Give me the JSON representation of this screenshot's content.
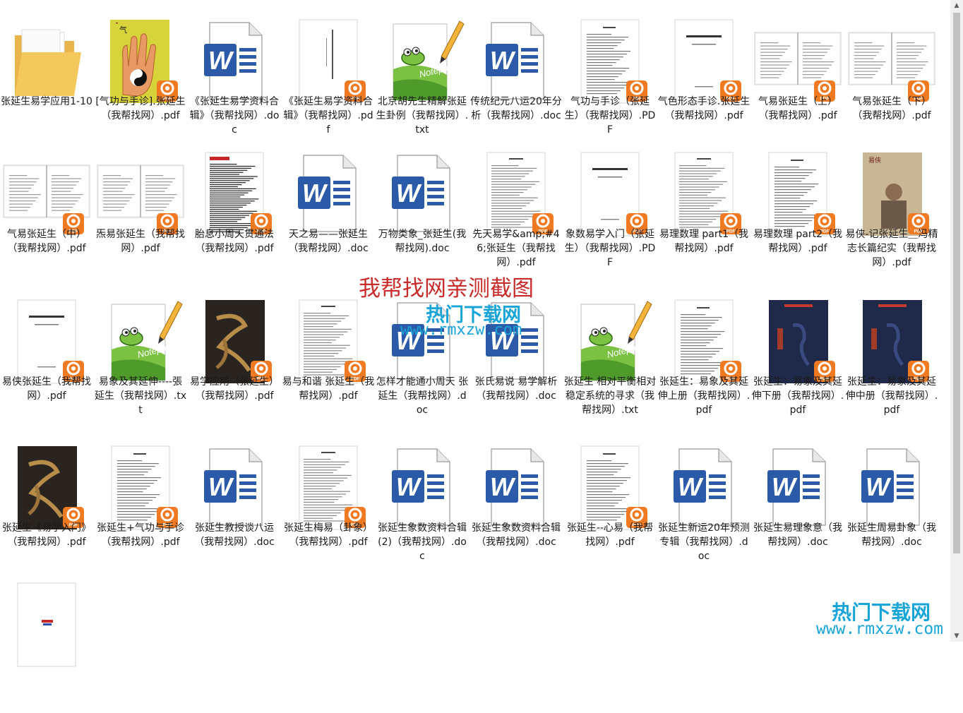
{
  "files": [
    {
      "type": "folder",
      "label": "张延生易学应用1-10"
    },
    {
      "type": "pdf",
      "cover": "hand",
      "label": "[气功与手诊].张延生（我帮找网）.pdf"
    },
    {
      "type": "doc",
      "label": "《张延生易学资料合辑》（我帮找网）.doc"
    },
    {
      "type": "pdf",
      "cover": "vtitle",
      "label": "《张延生易学资料合辑》（我帮找网）.pdf"
    },
    {
      "type": "txt",
      "label": "北京胡先生精解张延生卦例（我帮找网）.txt"
    },
    {
      "type": "doc",
      "label": "传统纪元八运20年分析（我帮找网）.doc"
    },
    {
      "type": "pdf",
      "cover": "toc",
      "label": "气功与手诊（张延生）（我帮找网）.PDF"
    },
    {
      "type": "pdf",
      "cover": "title",
      "label": "气色形态手诊.张延生（我帮找网）.pdf"
    },
    {
      "type": "pdf",
      "cover": "book",
      "label": "气易张延生（上）（我帮找网）.pdf"
    },
    {
      "type": "pdf",
      "cover": "book",
      "label": "气易张延生（下）（我帮找网）.pdf"
    },
    {
      "type": "pdf",
      "cover": "book",
      "label": "气易张延生（中）（我帮找网）.pdf"
    },
    {
      "type": "pdf",
      "cover": "book",
      "label": "炁易张延生（我帮找网）.pdf"
    },
    {
      "type": "pdf",
      "cover": "dense",
      "label": "胎息小周天贯通法（我帮找网）.pdf"
    },
    {
      "type": "doc",
      "label": "天之易——张延生（我帮找网）.doc"
    },
    {
      "type": "doc",
      "label": "万物类象_张延生(我帮找网).doc"
    },
    {
      "type": "pdf",
      "cover": "text",
      "label": "先天易学&amp;#46;张延生（我帮找网）.pdf"
    },
    {
      "type": "pdf",
      "cover": "title",
      "label": "象数易学入门（张延生）（我帮找网）.PDF"
    },
    {
      "type": "pdf",
      "cover": "text",
      "label": "易理数理 part1（我帮找网）.pdf"
    },
    {
      "type": "pdf",
      "cover": "toc",
      "label": "易理数理 part2（我帮找网）.pdf"
    },
    {
      "type": "pdf",
      "cover": "photo",
      "label": "易侠-记张延生＿冯精志长篇纪实（我帮找网）.pdf"
    },
    {
      "type": "pdf",
      "cover": "title",
      "label": "易侠张延生（我帮找网）.pdf"
    },
    {
      "type": "txt",
      "label": "易象及其延伸----張延生（我帮找网）.txt"
    },
    {
      "type": "pdf",
      "cover": "callig",
      "label": "易学应用（张延生）（我帮找网）.pdf"
    },
    {
      "type": "pdf",
      "cover": "text",
      "label": "易与和谐 张延生（我帮找网）.pdf"
    },
    {
      "type": "doc",
      "label": "怎样才能通小周天 张延生（我帮找网）.doc"
    },
    {
      "type": "doc",
      "label": "张氏易说 易学解析（我帮找网）.doc"
    },
    {
      "type": "txt",
      "label": "张延生 相对平衡相对稳定系统的寻求（我帮找网）.txt"
    },
    {
      "type": "pdf",
      "cover": "toc",
      "label": "张延生：易象及其延伸上册（我帮找网）.pdf"
    },
    {
      "type": "pdf",
      "cover": "navy",
      "label": "张延生：易象及其延伸下册（我帮找网）.pdf"
    },
    {
      "type": "pdf",
      "cover": "navy",
      "label": "张延生：易象及其延伸中册（我帮找网）.pdf"
    },
    {
      "type": "pdf",
      "cover": "callig",
      "label": "张延生《易学入门》（我帮找网）.pdf"
    },
    {
      "type": "pdf",
      "cover": "toc",
      "label": "张延生+气功与手诊（我帮找网）.pdf"
    },
    {
      "type": "doc",
      "label": "张延生教授谈八运（我帮找网）.doc"
    },
    {
      "type": "pdf",
      "cover": "text",
      "label": "张延生梅易（卦象）（我帮找网）.pdf"
    },
    {
      "type": "doc",
      "label": "张延生象数资料合辑 (2)（我帮找网）.doc"
    },
    {
      "type": "doc",
      "label": "张延生象数资料合辑（我帮找网）.doc"
    },
    {
      "type": "pdf",
      "cover": "toc",
      "label": "张延生--心易（我帮找网）.pdf"
    },
    {
      "type": "doc",
      "label": "张延生新运20年预测专辑（我帮找网）.doc"
    },
    {
      "type": "doc",
      "label": "张延生易理象意（我帮找网）.doc"
    },
    {
      "type": "doc",
      "label": "张延生周易卦象（我帮找网）.doc"
    },
    {
      "type": "pdf",
      "cover": "small",
      "label": ""
    }
  ],
  "watermarks": {
    "main_red": "我帮找网亲测截图",
    "center_blue": "热门下载网",
    "center_url": "www.rmxzw.com",
    "corner_blue": "热门下载网",
    "corner_url": "www.rmxzw.com"
  },
  "icons": {
    "pdf_badge_color": "#f07a22",
    "word_blue": "#2a5aa8",
    "folder_color": "#f3c95e"
  }
}
